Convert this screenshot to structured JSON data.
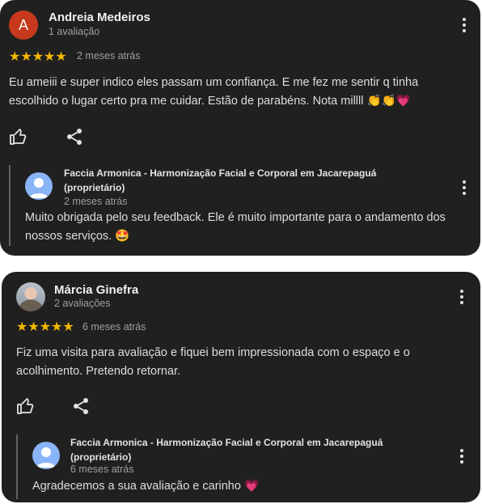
{
  "reviews": [
    {
      "author": "Andreia Medeiros",
      "avatar_letter": "A",
      "review_count": "1 avaliação",
      "stars": "★★★★★",
      "rating": 5,
      "date": "2 meses atrás",
      "text": "Eu ameiii e super indico eles passam um confiança. E me fez me sentir q tinha escolhido o lugar certo pra me cuidar. Estão de parabéns. Nota millll",
      "text_emoji": "👏👏💗",
      "owner_reply": {
        "owner_name": "Faccia Armonica - Harmonização Facial e Corporal em Jacarepaguá",
        "owner_tag": "(proprietário)",
        "date": "2 meses atrás",
        "text": "Muito obrigada pelo seu feedback. Ele é muito importante para o andamento dos nossos serviços.",
        "text_emoji": "🤩"
      }
    },
    {
      "author": "Márcia Ginefra",
      "review_count": "2 avaliações",
      "stars": "★★★★★",
      "rating": 5,
      "date": "6 meses atrás",
      "text": "Fiz uma visita para avaliação e fiquei bem impressionada com o espaço e o acolhimento. Pretendo retornar.",
      "owner_reply": {
        "owner_name": "Faccia Armonica - Harmonização Facial e Corporal em Jacarepaguá",
        "owner_tag": "(proprietário)",
        "date": "6 meses atrás",
        "text": "Agradecemos a sua avaliação e carinho",
        "text_emoji": "💗"
      }
    }
  ],
  "icons": {
    "like": "thumbs-up-icon",
    "share": "share-icon",
    "more": "more-vert-icon"
  },
  "colors": {
    "card_bg": "#202020",
    "star": "#f5b800",
    "avatar_letter_bg": "#c6391c",
    "owner_avatar_bg": "#8ab4f8",
    "heart": "#e8457a"
  }
}
